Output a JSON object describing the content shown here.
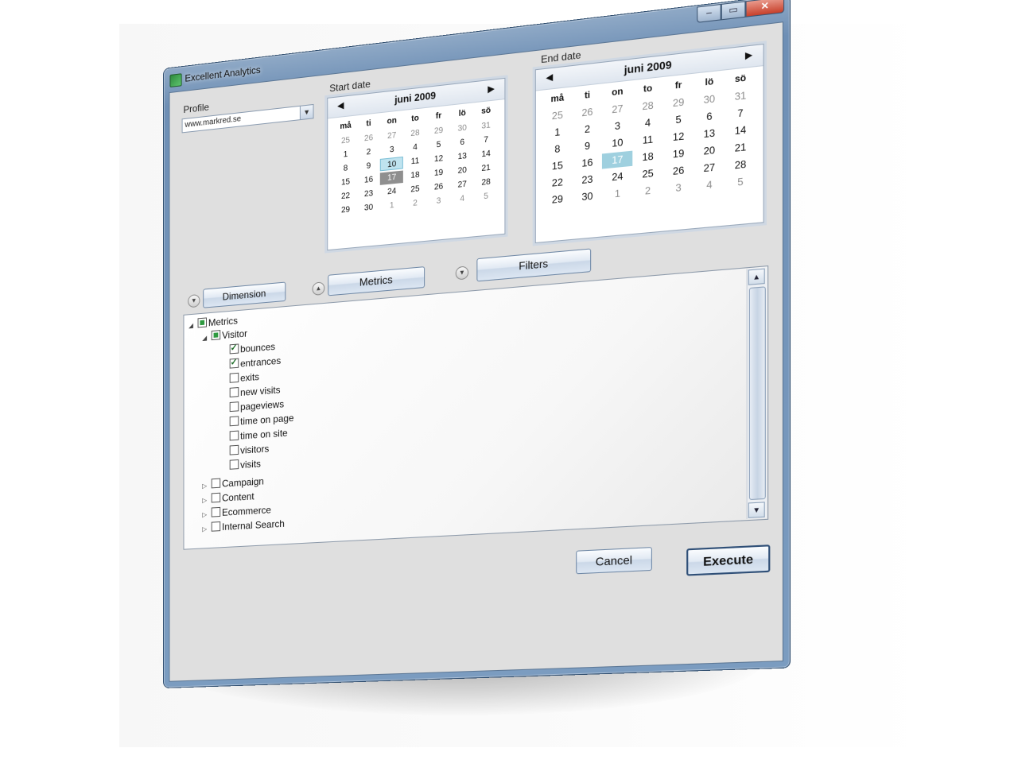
{
  "window": {
    "title": "Excellent Analytics",
    "controls": {
      "minimize": "–",
      "maximize": "▭",
      "close": "✕"
    }
  },
  "profile": {
    "label": "Profile",
    "value": "www.markred.se"
  },
  "start_date": {
    "label": "Start date",
    "month": "juni 2009",
    "weekdays": [
      "må",
      "ti",
      "on",
      "to",
      "fr",
      "lö",
      "sö"
    ],
    "weeks": [
      [
        "25",
        "26",
        "27",
        "28",
        "29",
        "30",
        "31"
      ],
      [
        "1",
        "2",
        "3",
        "4",
        "5",
        "6",
        "7"
      ],
      [
        "8",
        "9",
        "10",
        "11",
        "12",
        "13",
        "14"
      ],
      [
        "15",
        "16",
        "17",
        "18",
        "19",
        "20",
        "21"
      ],
      [
        "22",
        "23",
        "24",
        "25",
        "26",
        "27",
        "28"
      ],
      [
        "29",
        "30",
        "1",
        "2",
        "3",
        "4",
        "5"
      ]
    ],
    "selected": "10",
    "today": "17"
  },
  "end_date": {
    "label": "End date",
    "month": "juni 2009",
    "weekdays": [
      "må",
      "ti",
      "on",
      "to",
      "fr",
      "lö",
      "sö"
    ],
    "weeks": [
      [
        "25",
        "26",
        "27",
        "28",
        "29",
        "30",
        "31"
      ],
      [
        "1",
        "2",
        "3",
        "4",
        "5",
        "6",
        "7"
      ],
      [
        "8",
        "9",
        "10",
        "11",
        "12",
        "13",
        "14"
      ],
      [
        "15",
        "16",
        "17",
        "18",
        "19",
        "20",
        "21"
      ],
      [
        "22",
        "23",
        "24",
        "25",
        "26",
        "27",
        "28"
      ],
      [
        "29",
        "30",
        "1",
        "2",
        "3",
        "4",
        "5"
      ]
    ],
    "selected": "17"
  },
  "panels": {
    "dimension": "Dimension",
    "metrics": "Metrics",
    "filters": "Filters"
  },
  "tree": {
    "root": "Metrics",
    "group": "Visitor",
    "items": [
      {
        "label": "bounces",
        "checked": true
      },
      {
        "label": "entrances",
        "checked": true
      },
      {
        "label": "exits",
        "checked": false
      },
      {
        "label": "new visits",
        "checked": false
      },
      {
        "label": "pageviews",
        "checked": false
      },
      {
        "label": "time on page",
        "checked": false
      },
      {
        "label": "time on site",
        "checked": false
      },
      {
        "label": "visitors",
        "checked": false
      },
      {
        "label": "visits",
        "checked": false
      }
    ],
    "collapsed_groups": [
      "Campaign",
      "Content",
      "Ecommerce",
      "Internal Search"
    ]
  },
  "buttons": {
    "cancel": "Cancel",
    "execute": "Execute"
  }
}
